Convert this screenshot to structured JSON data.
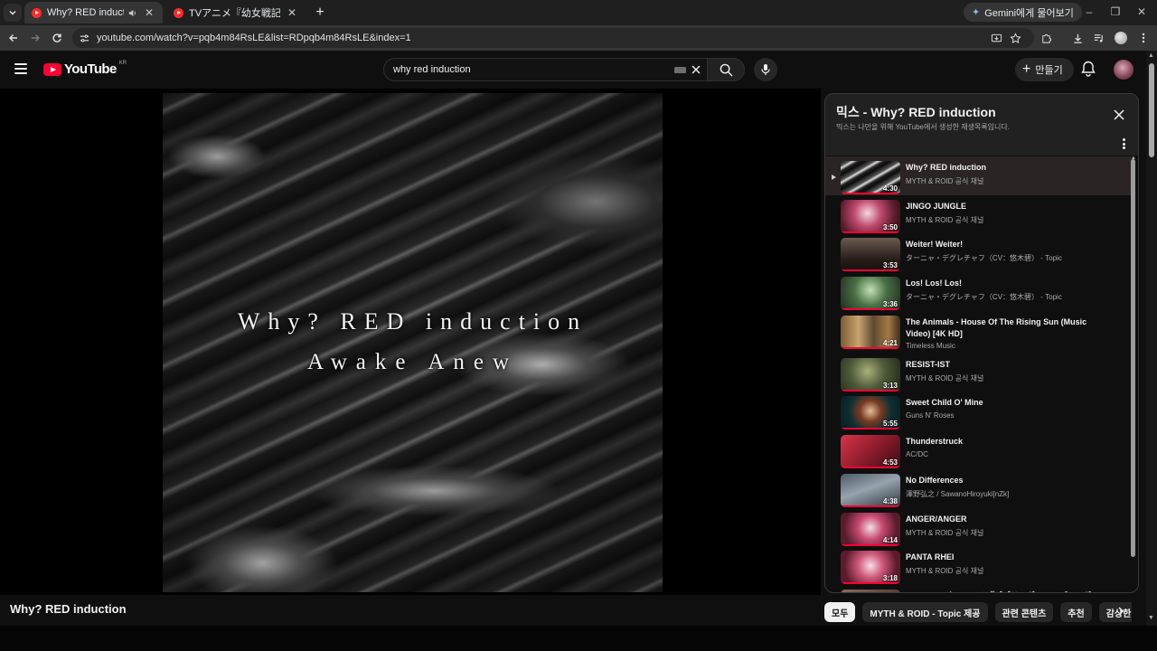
{
  "browser": {
    "tabs": [
      {
        "title": "Why? RED induction - YouTube",
        "active": true
      },
      {
        "title": "TVアニメ『幼女戦記』ノンクレジット",
        "active": false
      }
    ],
    "gemini_label": "Gemini에게 물어보기",
    "url": "youtube.com/watch?v=pqb4m84RsLE&list=RDpqb4m84RsLE&index=1"
  },
  "masthead": {
    "logo_text": "YouTube",
    "country": "KR",
    "search_value": "why red induction",
    "create_label": "만들기"
  },
  "video": {
    "line1": "Why? RED induction",
    "line2": "Awake Anew",
    "title": "Why? RED induction"
  },
  "playlist": {
    "title": "믹스 - Why? RED induction",
    "subtitle": "믹스는 나만을 위해 YouTube에서 생성한 재생목록입니다.",
    "items": [
      {
        "title": "Why? RED induction",
        "channel": "MYTH & ROID 공식 채널",
        "duration": "4:30",
        "thumb": "why",
        "current": true
      },
      {
        "title": "JINGO JUNGLE",
        "channel": "MYTH & ROID 공식 채널",
        "duration": "3:50",
        "thumb": "anime"
      },
      {
        "title": "Weiter! Weiter!",
        "channel": "ターニャ・デグレチャフ（CV：悠木碧） - Topic",
        "duration": "3:53",
        "thumb": "weiter"
      },
      {
        "title": "Los! Los! Los!",
        "channel": "ターニャ・デグレチャフ（CV：悠木碧） - Topic",
        "duration": "3:36",
        "thumb": "los"
      },
      {
        "title": "The Animals - House Of The Rising Sun (Music Video) [4K HD]",
        "channel": "Timeless Music",
        "duration": "4:21",
        "thumb": "animals",
        "tall": true
      },
      {
        "title": "RESIST-IST",
        "channel": "MYTH & ROID 공식 채널",
        "duration": "3:13",
        "thumb": "resist"
      },
      {
        "title": "Sweet Child O' Mine",
        "channel": "Guns N' Roses",
        "duration": "5:55",
        "thumb": "sweet"
      },
      {
        "title": "Thunderstruck",
        "channel": "AC/DC",
        "duration": "4:53",
        "thumb": "thunder"
      },
      {
        "title": "No Differences",
        "channel": "澤野弘之 / SawanoHiroyuki[nZk]",
        "duration": "4:38",
        "thumb": "nodiff"
      },
      {
        "title": "ANGER/ANGER",
        "channel": "MYTH & ROID 공식 채널",
        "duration": "4:14",
        "thumb": "anger"
      },
      {
        "title": "PANTA RHEI",
        "channel": "MYTH & ROID 공식 채널",
        "duration": "3:18",
        "thumb": "panta"
      },
      {
        "title": "Rightfully（TVアニメ『ブブリング』エンディング - OP Ver.）",
        "channel": "",
        "duration": "",
        "thumb": "right"
      }
    ]
  },
  "chips": [
    "모두",
    "MYTH & ROID - Topic 제공",
    "관련 콘텐츠",
    "추천",
    "감상한 동영상"
  ],
  "colors": {
    "brand": "#ff0033",
    "background": "#0f0f0f",
    "panel_header": "#212121"
  }
}
